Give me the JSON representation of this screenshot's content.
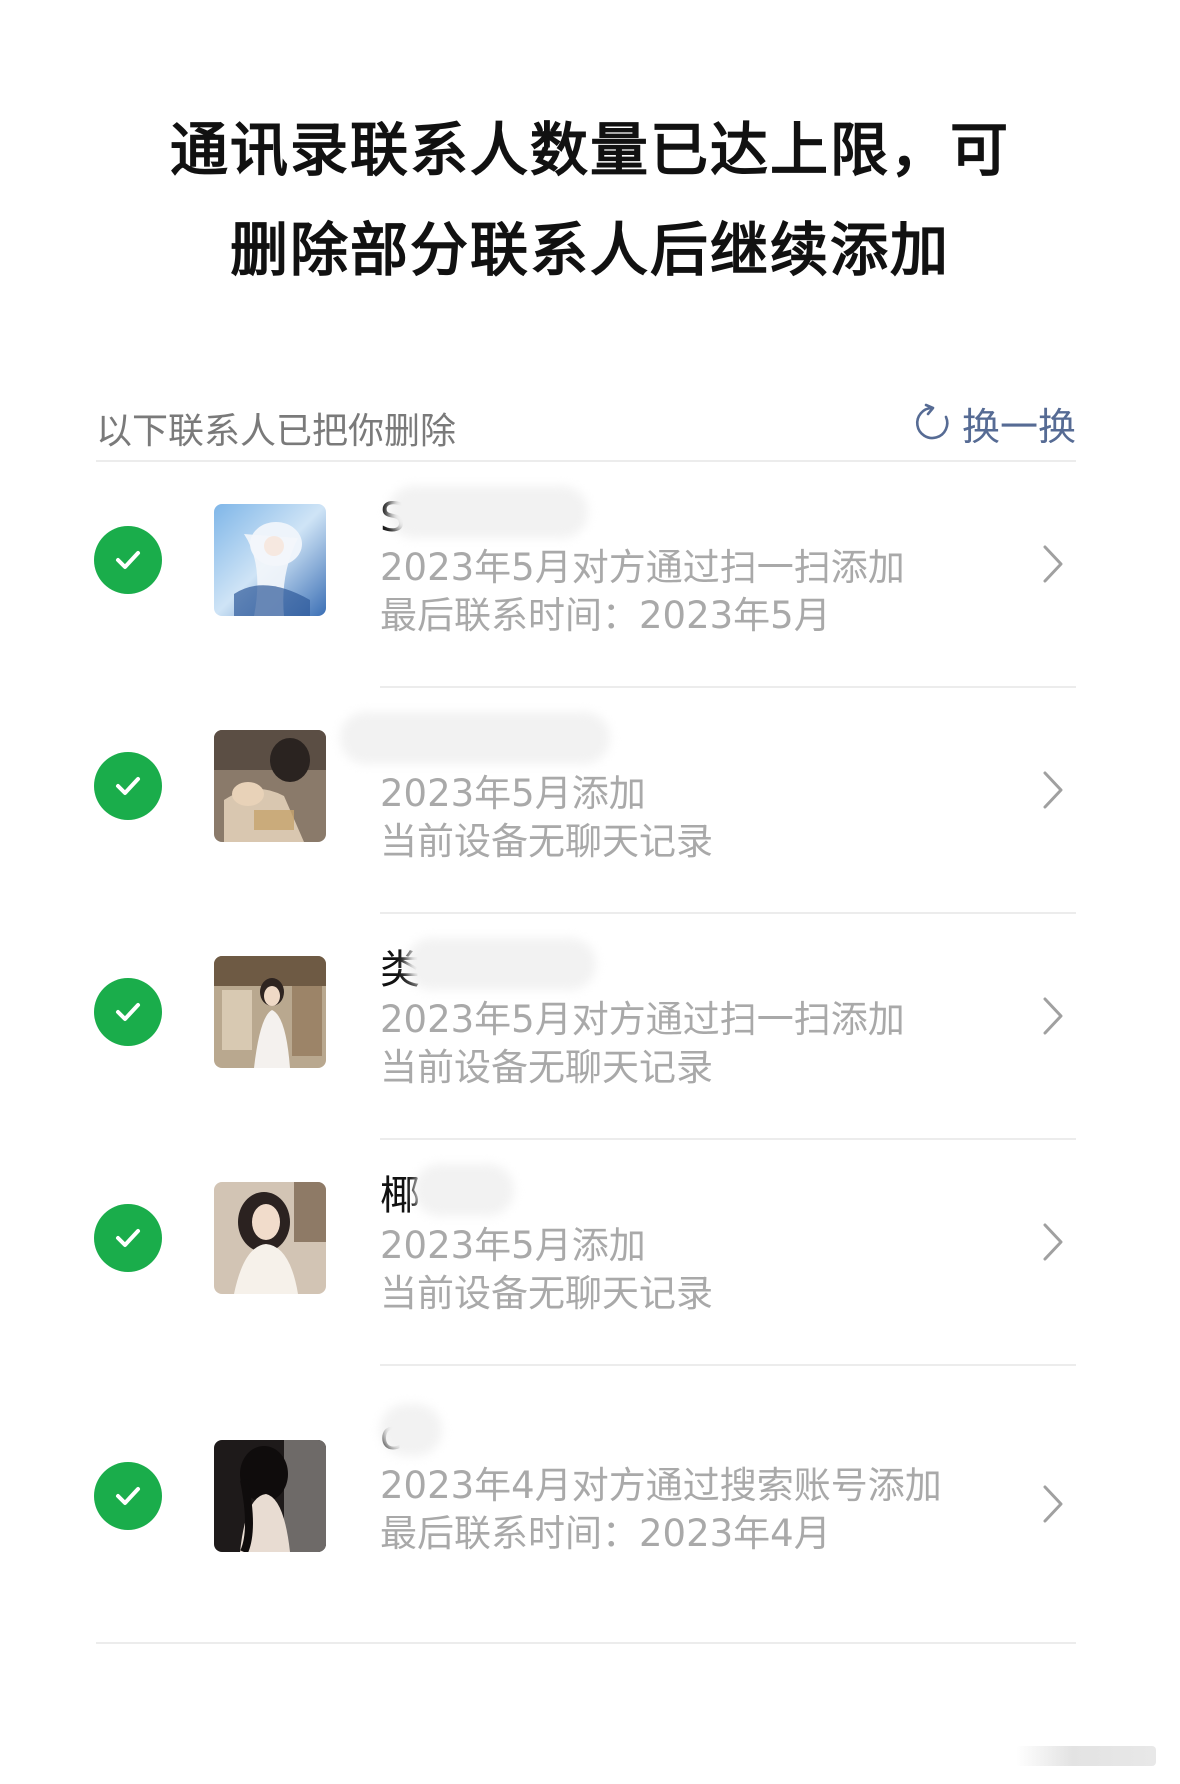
{
  "title": {
    "line1": "通讯录联系人数量已达上限，可",
    "line2": "删除部分联系人后继续添加"
  },
  "section": {
    "label": "以下联系人已把你删除",
    "refresh_label": "换一换"
  },
  "colors": {
    "check": "#1aad4b",
    "link": "#566b94",
    "muted_text": "#a9a9a9"
  },
  "contacts": [
    {
      "name": "S",
      "added": "2023年5月对方通过扫一扫添加",
      "status": "最后联系时间：2023年5月",
      "selected": true
    },
    {
      "name": "",
      "added": "2023年5月添加",
      "status": "当前设备无聊天记录",
      "selected": true
    },
    {
      "name": "类",
      "added": "2023年5月对方通过扫一扫添加",
      "status": "当前设备无聊天记录",
      "selected": true
    },
    {
      "name": "椰",
      "added": "2023年5月添加",
      "status": "当前设备无聊天记录",
      "selected": true
    },
    {
      "name": "c",
      "added": "2023年4月对方通过搜索账号添加",
      "status": "最后联系时间：2023年4月",
      "selected": true
    }
  ]
}
